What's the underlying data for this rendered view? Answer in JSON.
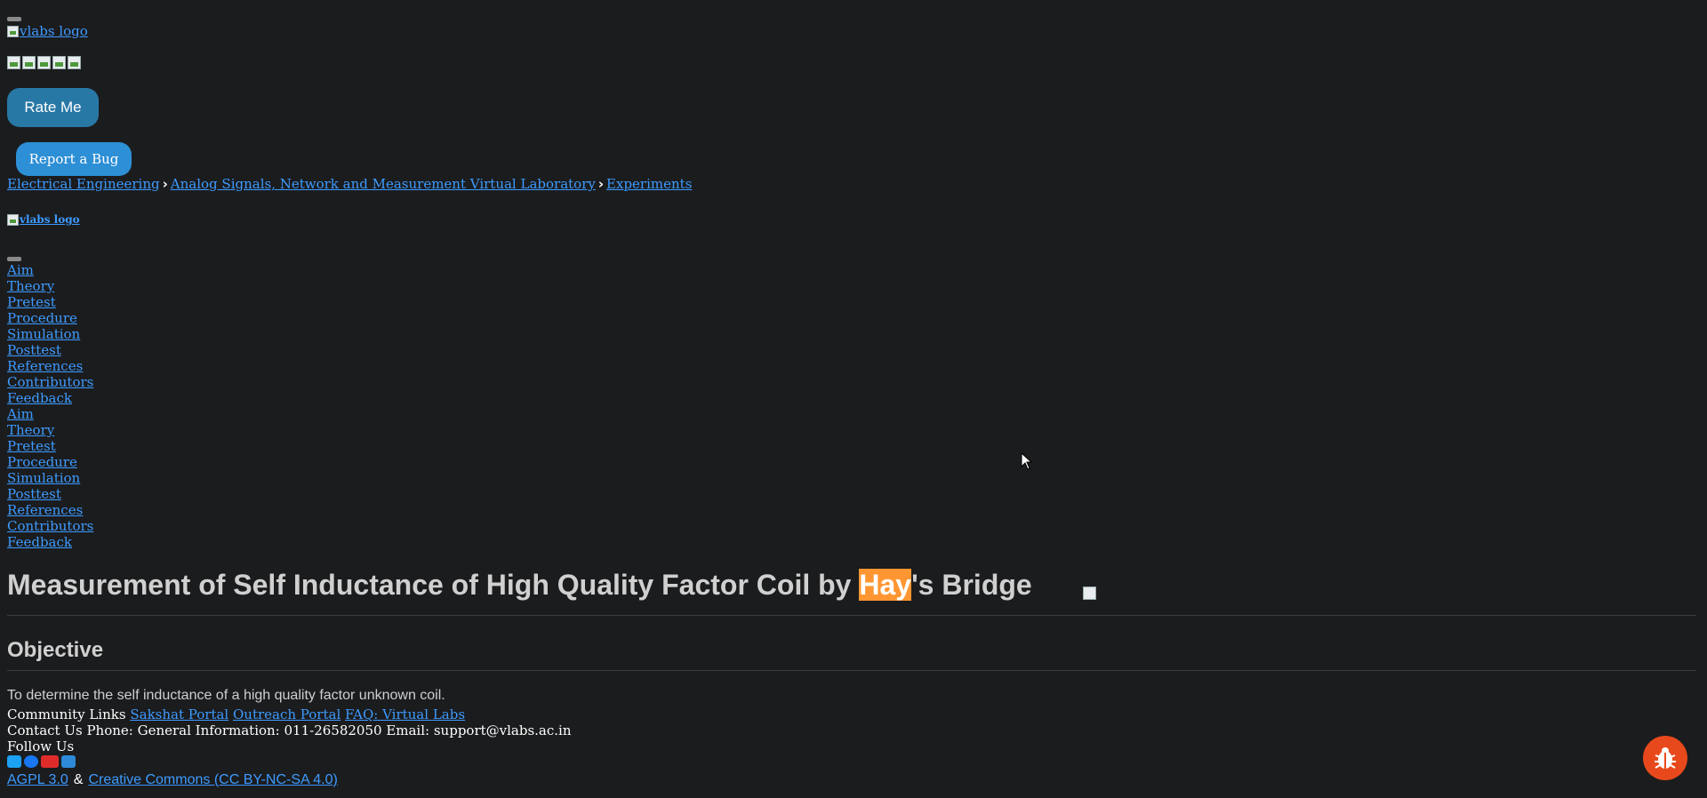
{
  "header": {
    "logo_alt": "vlabs logo",
    "rate_me": "Rate Me",
    "report_bug": "Report a Bug"
  },
  "breadcrumb": {
    "items": [
      "Electrical Engineering",
      "Analog Signals, Network and Measurement Virtual Laboratory",
      "Experiments"
    ]
  },
  "sidebar": {
    "logo_alt": "vlabs logo",
    "items": [
      "Aim",
      "Theory",
      "Pretest",
      "Procedure",
      "Simulation",
      "Posttest",
      "References",
      "Contributors",
      "Feedback",
      "Aim",
      "Theory",
      "Pretest",
      "Procedure",
      "Simulation",
      "Posttest",
      "References",
      "Contributors",
      "Feedback"
    ]
  },
  "main": {
    "title_before": "Measurement of Self Inductance of High Quality Factor Coil by ",
    "title_highlight": "Hay",
    "title_after": "'s Bridge",
    "section_heading": "Objective",
    "objective_text": "To determine the self inductance of a high quality factor unknown coil."
  },
  "footer": {
    "community_label": "Community Links",
    "community_links": [
      "Sakshat Portal",
      "Outreach Portal",
      "FAQ: Virtual Labs"
    ],
    "contact": "Contact Us Phone: General Information: 011-26582050 Email: support@vlabs.ac.in",
    "follow_us": "Follow Us",
    "social_icons": [
      "twitter-icon",
      "facebook-icon",
      "youtube-icon",
      "linkedin-icon"
    ],
    "license_1": "AGPL 3.0",
    "amp": "&",
    "license_2": "Creative Commons (CC BY-NC-SA 4.0)"
  },
  "colors": {
    "background": "#1b1c1e",
    "link": "#3d9bff",
    "highlight": "#ff9632",
    "rate_button": "#2878a6",
    "bug_button": "#2d8fd5",
    "bug_fab": "#e8491c"
  }
}
